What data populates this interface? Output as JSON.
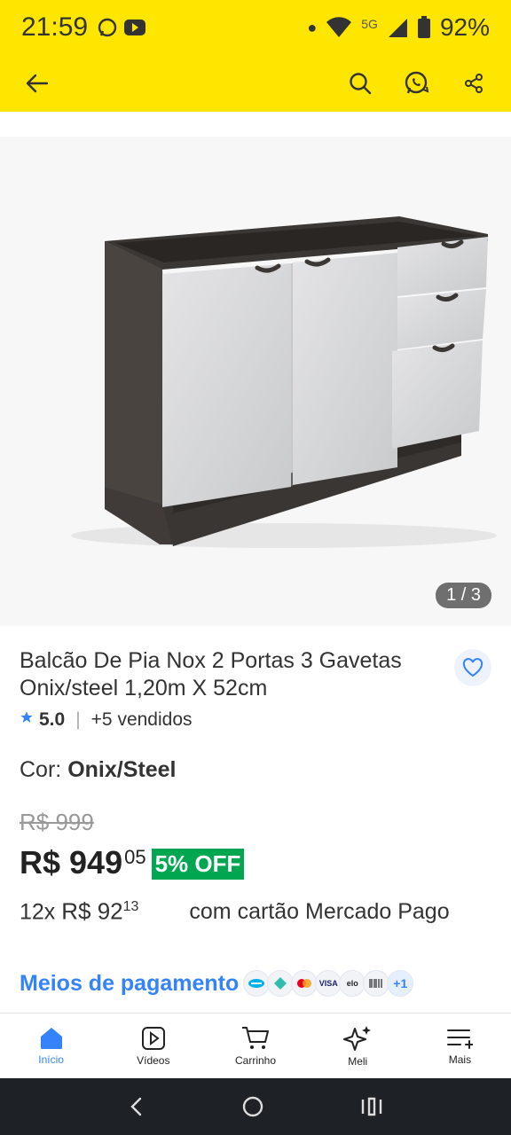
{
  "status": {
    "time": "21:59",
    "network": "5G",
    "battery": "92%"
  },
  "appbar": {
    "icons": [
      "back-arrow-icon",
      "search-icon",
      "whatsapp-icon",
      "share-icon"
    ]
  },
  "gallery": {
    "counter": "1 / 3"
  },
  "product": {
    "title": "Balcão De Pia Nox 2 Portas 3 Gavetas Onix/steel 1,20m X 52cm",
    "rating": "5.0",
    "sold": "+5 vendidos",
    "color_label": "Cor: ",
    "color_value": "Onix/Steel",
    "old_price": "R$ 999",
    "price_main": "R$ 949",
    "price_cents": "05",
    "off": "5% OFF",
    "installments_prefix": "12x",
    "installment_amount": "R$ 92",
    "installment_cents": "13",
    "installments_suffix": "com cartão Mercado Pago",
    "payment_link": "Meios de pagamento",
    "payment_more": "+1"
  },
  "tabs": [
    {
      "label": "Início",
      "icon": "home-icon",
      "active": true
    },
    {
      "label": "Vídeos",
      "icon": "video-icon",
      "active": false
    },
    {
      "label": "Carrinho",
      "icon": "cart-icon",
      "active": false
    },
    {
      "label": "Meli",
      "icon": "sparkle-icon",
      "active": false
    },
    {
      "label": "Mais",
      "icon": "menu-icon",
      "active": false
    }
  ],
  "colors": {
    "brand_yellow": "#ffe600",
    "link_blue": "#3483fa",
    "discount_green": "#00a650"
  }
}
